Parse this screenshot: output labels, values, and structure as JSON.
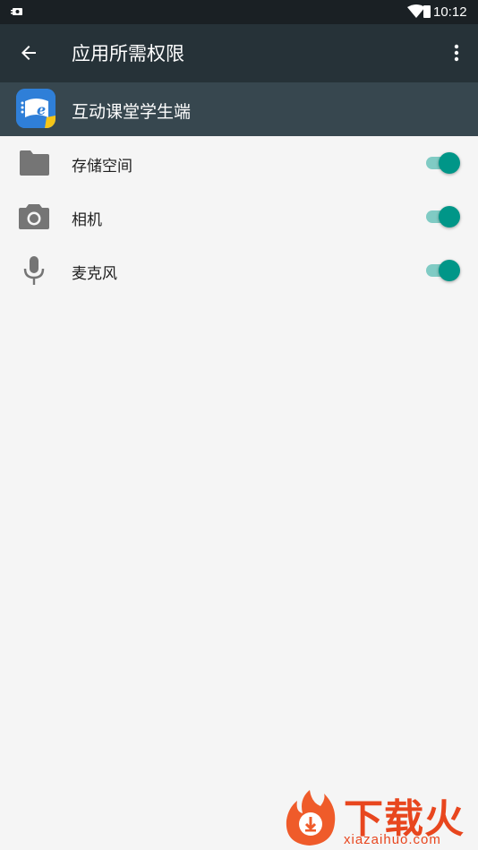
{
  "status_bar": {
    "time": "10:12"
  },
  "app_bar": {
    "title": "应用所需权限"
  },
  "app_header": {
    "app_name": "互动课堂学生端"
  },
  "permissions": [
    {
      "label": "存储空间",
      "icon": "folder-icon",
      "enabled": true
    },
    {
      "label": "相机",
      "icon": "camera-icon",
      "enabled": true
    },
    {
      "label": "麦克风",
      "icon": "microphone-icon",
      "enabled": true
    }
  ],
  "colors": {
    "app_bar": "#263238",
    "app_header": "#37474f",
    "toggle_on": "#009688",
    "toggle_track": "#80cbc4"
  },
  "watermark": {
    "title": "下载火",
    "subtitle": "xiazaihuo.com"
  }
}
